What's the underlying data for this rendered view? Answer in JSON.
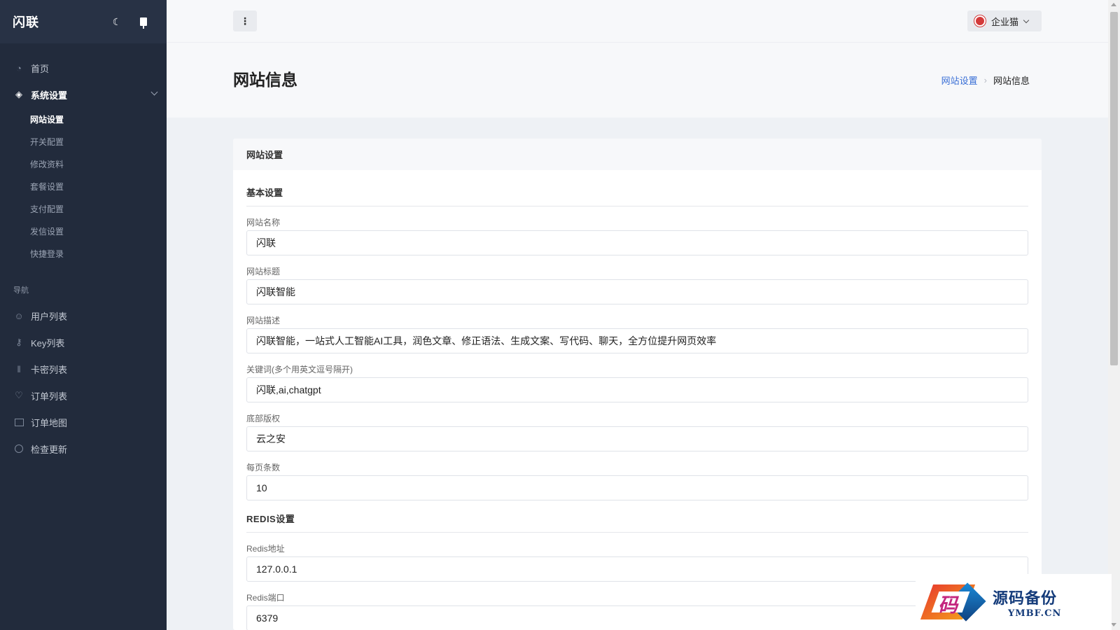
{
  "sidebar": {
    "brand": "闪联",
    "menu": [
      {
        "label": "首页"
      },
      {
        "label": "系统设置"
      }
    ],
    "submenu": [
      {
        "label": "网站设置"
      },
      {
        "label": "开关配置"
      },
      {
        "label": "修改资料"
      },
      {
        "label": "套餐设置"
      },
      {
        "label": "支付配置"
      },
      {
        "label": "发信设置"
      },
      {
        "label": "快捷登录"
      }
    ],
    "section_label": "导航",
    "nav": [
      {
        "label": "用户列表"
      },
      {
        "label": "Key列表"
      },
      {
        "label": "卡密列表"
      },
      {
        "label": "订单列表"
      },
      {
        "label": "订单地图"
      },
      {
        "label": "检查更新"
      }
    ]
  },
  "topbar": {
    "more_icon": "⋮",
    "user_name": "企业猫"
  },
  "page": {
    "title": "网站信息",
    "breadcrumb": {
      "parent": "网站设置",
      "current": "网站信息"
    }
  },
  "card": {
    "header": "网站设置",
    "basic_section": "基本设置",
    "fields": {
      "site_name": {
        "label": "网站名称",
        "value": "闪联"
      },
      "site_title": {
        "label": "网站标题",
        "value": "闪联智能"
      },
      "site_desc": {
        "label": "网站描述",
        "value": "闪联智能，一站式人工智能AI工具，润色文章、修正语法、生成文案、写代码、聊天，全方位提升网页效率"
      },
      "keywords": {
        "label": "关键词(多个用英文逗号隔开)",
        "value": "闪联,ai,chatgpt"
      },
      "copyright": {
        "label": "底部版权",
        "value": "云之安"
      },
      "per_page": {
        "label": "每页条数",
        "value": "10"
      }
    },
    "redis_section": "REDIS设置",
    "redis": {
      "host": {
        "label": "Redis地址",
        "value": "127.0.0.1"
      },
      "port": {
        "label": "Redis端口",
        "value": "6379"
      }
    }
  },
  "watermark": {
    "logo_char": "码",
    "name_cn": "源码备份",
    "name_en": "YMBF.CN"
  }
}
